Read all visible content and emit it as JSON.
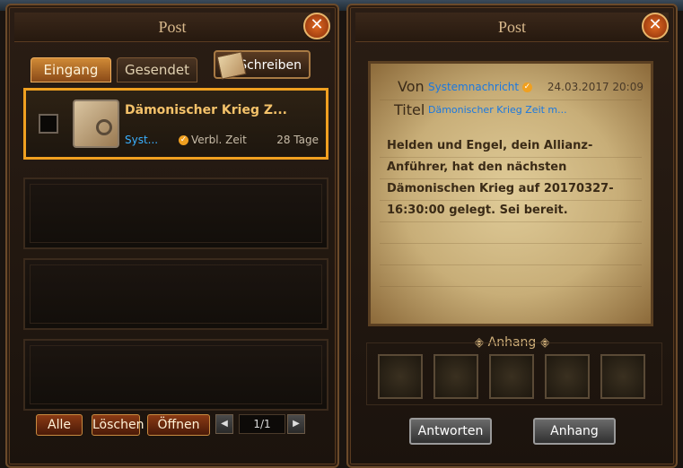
{
  "left_panel": {
    "title": "Post",
    "close": "✕",
    "tabs": [
      {
        "label": "Eingang",
        "active": true
      },
      {
        "label": "Gesendet",
        "active": false
      }
    ],
    "write_button": "Schreiben",
    "mails": [
      {
        "subject": "Dämonischer Krieg Z...",
        "sender": "Syst...",
        "remaining_label": "Verbl. Zeit",
        "days": "28 Tage",
        "selected": true
      }
    ],
    "buttons": {
      "all": "Alle",
      "delete": "Löschen",
      "open": "Öffnen"
    },
    "page_indicator": "1/1",
    "prev_arrow": "◀",
    "next_arrow": "▶"
  },
  "right_panel": {
    "title": "Post",
    "close": "✕",
    "from_label": "Von",
    "from_value": "Systemnachricht",
    "date": "24.03.2017 20:09",
    "title_label": "Titel",
    "title_value": "Dämonischer Krieg Zeit m...",
    "body": "Helden und Engel, dein Allianz-Anführer, hat den nächsten Dämonischen Krieg auf 20170327-16:30:00 gelegt. Sei bereit.",
    "attachment_header": "Anhang",
    "reply_button": "Antworten",
    "attachment_button": "Anhang"
  },
  "icons": {
    "verified": "check-badge-icon",
    "mail": "letter-icon",
    "write": "quill-scroll-icon"
  }
}
